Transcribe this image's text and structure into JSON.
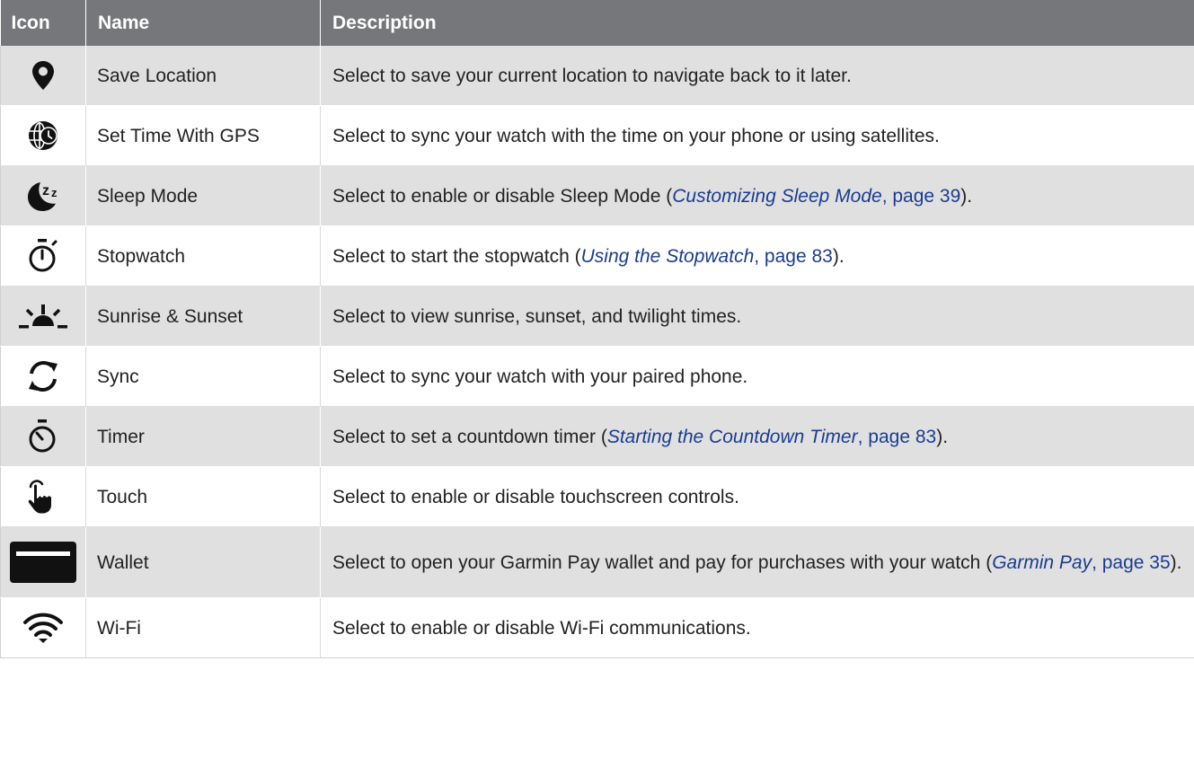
{
  "table": {
    "headers": {
      "icon": "Icon",
      "name": "Name",
      "description": "Description"
    },
    "rows": [
      {
        "icon": "map-pin-icon",
        "name": "Save Location",
        "desc": {
          "pre": "Select to save your current location to navigate back to it later."
        }
      },
      {
        "icon": "globe-clock-icon",
        "name": "Set Time With GPS",
        "desc": {
          "pre": "Select to sync your watch with the time on your phone or using satellites."
        }
      },
      {
        "icon": "moon-zz-icon",
        "name": "Sleep Mode",
        "desc": {
          "pre": "Select to enable or disable Sleep Mode (",
          "link": "Customizing Sleep Mode",
          "page": ", page 39",
          "post": ")."
        }
      },
      {
        "icon": "stopwatch-icon",
        "name": "Stopwatch",
        "desc": {
          "pre": "Select to start the stopwatch (",
          "link": "Using the Stopwatch",
          "page": ", page 83",
          "post": ")."
        }
      },
      {
        "icon": "sunrise-icon",
        "name": "Sunrise & Sunset",
        "desc": {
          "pre": "Select to view sunrise, sunset, and twilight times."
        }
      },
      {
        "icon": "sync-arrows-icon",
        "name": "Sync",
        "desc": {
          "pre": "Select to sync your watch with your paired phone."
        }
      },
      {
        "icon": "timer-icon",
        "name": "Timer",
        "desc": {
          "pre": "Select to set a countdown timer (",
          "link": "Starting the Countdown Timer",
          "page": ", page 83",
          "post": ")."
        }
      },
      {
        "icon": "touch-hand-icon",
        "name": "Touch",
        "desc": {
          "pre": "Select to enable or disable touchscreen controls."
        }
      },
      {
        "icon": "wallet-card-icon",
        "name": "Wallet",
        "desc": {
          "pre": "Select to open your Garmin Pay wallet and pay for purchases with your watch (",
          "link": "Garmin Pay",
          "page": ", page 35",
          "post": ")."
        }
      },
      {
        "icon": "wifi-icon",
        "name": "Wi-Fi",
        "desc": {
          "pre": "Select to enable or disable Wi-Fi communications."
        }
      }
    ]
  },
  "colors": {
    "header_bg": "#76777a",
    "row_shade": "#e0e0e0",
    "link": "#1a3c8f",
    "icon": "#111111"
  }
}
